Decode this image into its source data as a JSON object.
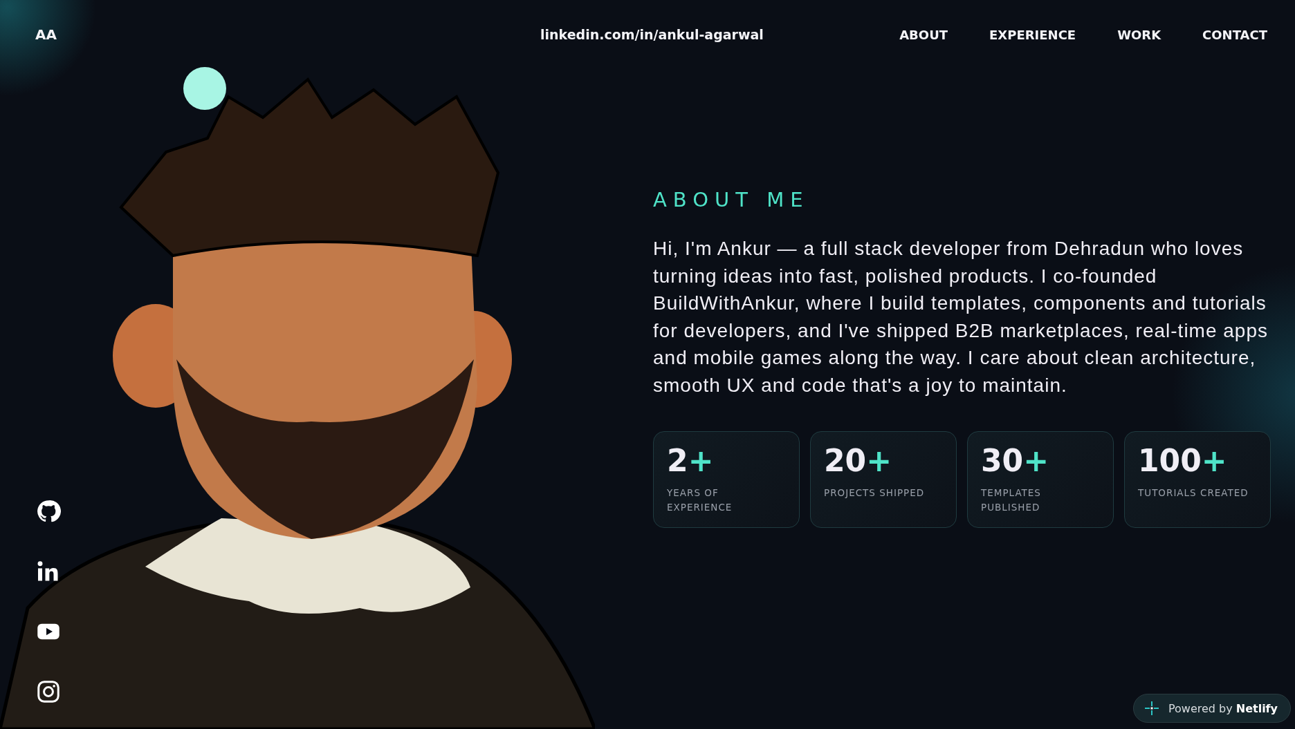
{
  "logo": "AA",
  "header_link": "linkedin.com/in/ankul-agarwal",
  "nav": [
    "ABOUT",
    "EXPERIENCE",
    "WORK",
    "CONTACT"
  ],
  "about": {
    "heading": "ABOUT ME",
    "text": "Hi, I'm Ankur — a full stack developer from Dehradun who loves turning ideas into fast, polished products. I co-founded BuildWithAnkur, where I build templates, components and tutorials for developers, and I've shipped B2B marketplaces, real-time apps and mobile games along the way. I care about clean architecture, smooth UX and code that's a joy to maintain."
  },
  "stats": [
    {
      "value": "2",
      "suffix": "+",
      "label": "YEARS OF EXPERIENCE"
    },
    {
      "value": "20",
      "suffix": "+",
      "label": "PROJECTS SHIPPED"
    },
    {
      "value": "30",
      "suffix": "+",
      "label": "TEMPLATES PUBLISHED"
    },
    {
      "value": "100",
      "suffix": "+",
      "label": "TUTORIALS CREATED"
    }
  ],
  "socials": [
    {
      "kind": "github"
    },
    {
      "kind": "linkedin"
    },
    {
      "kind": "youtube"
    },
    {
      "kind": "instagram"
    }
  ],
  "badge": {
    "prefix": "Powered by",
    "brand": "Netlify"
  }
}
